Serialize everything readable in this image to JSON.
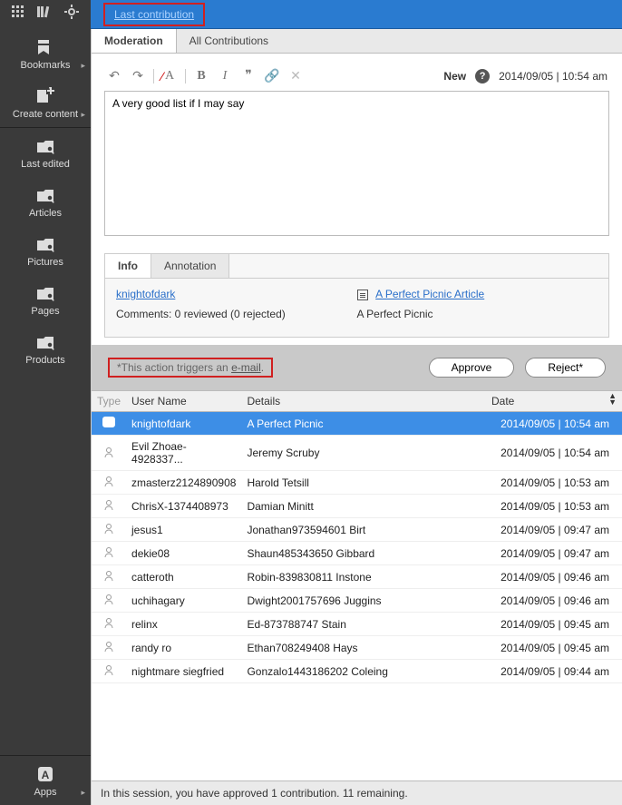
{
  "topbar": {
    "tab": "Last contribution"
  },
  "toolpane": {
    "bookmarks": "Bookmarks",
    "create": "Create content",
    "last_edited": "Last edited",
    "articles": "Articles",
    "pictures": "Pictures",
    "pages": "Pages",
    "products": "Products",
    "apps": "Apps"
  },
  "tabs": {
    "moderation": "Moderation",
    "all": "All Contributions"
  },
  "editor": {
    "status": "New",
    "timestamp": "2014/09/05 | 10:54 am",
    "text": "A very good list if I may say"
  },
  "info": {
    "tab_info": "Info",
    "tab_annotation": "Annotation",
    "user": "knightofdark",
    "comments": "Comments: 0 reviewed (0 rejected)",
    "article_link": "A Perfect Picnic Article",
    "article_sub": "A Perfect Picnic"
  },
  "actions": {
    "trigger_prefix": "*This action triggers an ",
    "trigger_link": "e-mail",
    "approve": "Approve",
    "reject": "Reject*"
  },
  "grid": {
    "headers": {
      "type": "Type",
      "user": "User Name",
      "details": "Details",
      "date": "Date"
    },
    "rows": [
      {
        "icon": "bubble",
        "user": "knightofdark",
        "details": "A Perfect Picnic",
        "date": "2014/09/05 | 10:54 am",
        "selected": true
      },
      {
        "icon": "person",
        "user": "Evil Zhoae-4928337...",
        "details": "Jeremy Scruby",
        "date": "2014/09/05 | 10:54 am"
      },
      {
        "icon": "person",
        "user": "zmasterz2124890908",
        "details": "Harold Tetsill",
        "date": "2014/09/05 | 10:53 am"
      },
      {
        "icon": "person",
        "user": "ChrisX-1374408973",
        "details": "Damian Minitt",
        "date": "2014/09/05 | 10:53 am"
      },
      {
        "icon": "person",
        "user": "jesus1",
        "details": "Jonathan973594601 Birt",
        "date": "2014/09/05 | 09:47 am"
      },
      {
        "icon": "person",
        "user": "dekie08",
        "details": "Shaun485343650 Gibbard",
        "date": "2014/09/05 | 09:47 am"
      },
      {
        "icon": "person",
        "user": "catteroth",
        "details": "Robin-839830811 Instone",
        "date": "2014/09/05 | 09:46 am"
      },
      {
        "icon": "person",
        "user": "uchihagary",
        "details": "Dwight2001757696 Juggins",
        "date": "2014/09/05 | 09:46 am"
      },
      {
        "icon": "person",
        "user": "relinx",
        "details": "Ed-873788747 Stain",
        "date": "2014/09/05 | 09:45 am"
      },
      {
        "icon": "person",
        "user": "randy ro",
        "details": "Ethan708249408 Hays",
        "date": "2014/09/05 | 09:45 am"
      },
      {
        "icon": "person",
        "user": "nightmare siegfried",
        "details": "Gonzalo1443186202 Coleing",
        "date": "2014/09/05 | 09:44 am"
      }
    ]
  },
  "status": "In this session, you have approved 1 contribution. 11 remaining."
}
